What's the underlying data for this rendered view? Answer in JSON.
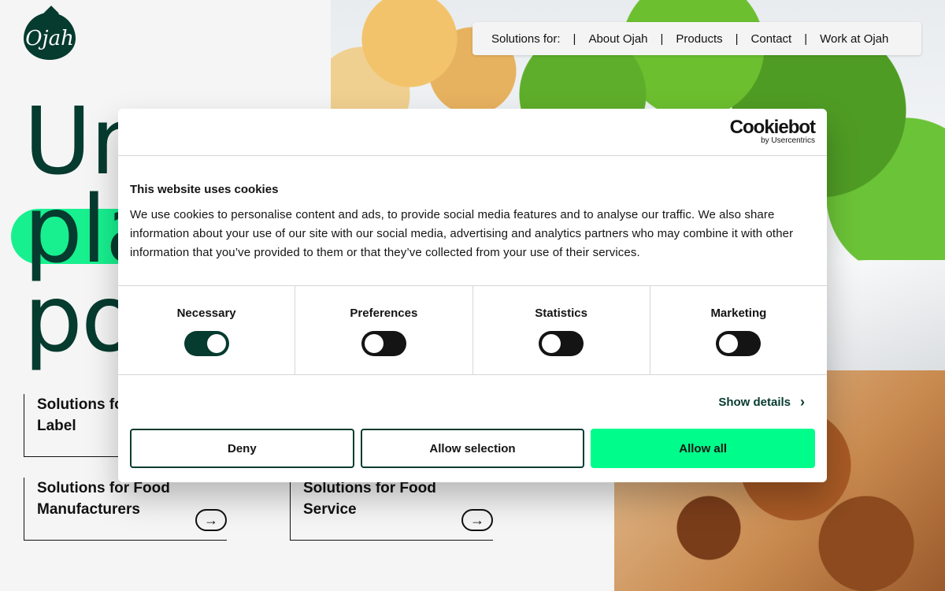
{
  "brand": {
    "logo_text": "Ojah"
  },
  "nav": {
    "items": [
      "Solutions for:",
      "About Ojah",
      "Products",
      "Contact",
      "Work at Ojah"
    ]
  },
  "hero": {
    "lines": [
      "Un",
      "pla",
      "po"
    ]
  },
  "solutions": [
    {
      "title": "Solutions for Private Label"
    },
    {
      "title": "Solutions for Food Manufacturers"
    },
    {
      "title": "Solutions for Food Service"
    }
  ],
  "cookie": {
    "provider_name": "Cookiebot",
    "provider_sub": "by Usercentrics",
    "title": "This website uses cookies",
    "text": "We use cookies to personalise content and ads, to provide social media features and to analyse our traffic. We also share information about your use of our site with our social media, advertising and analytics partners who may combine it with other information that you’ve provided to them or that they’ve collected from your use of their services.",
    "categories": [
      {
        "label": "Necessary",
        "checked": true
      },
      {
        "label": "Preferences",
        "checked": false
      },
      {
        "label": "Statistics",
        "checked": false
      },
      {
        "label": "Marketing",
        "checked": false
      }
    ],
    "show_details": "Show details",
    "buttons": {
      "deny": "Deny",
      "allow_selection": "Allow selection",
      "allow_all": "Allow all"
    }
  },
  "colors": {
    "brand_dark": "#063b2f",
    "accent_green": "#00fd8b"
  }
}
